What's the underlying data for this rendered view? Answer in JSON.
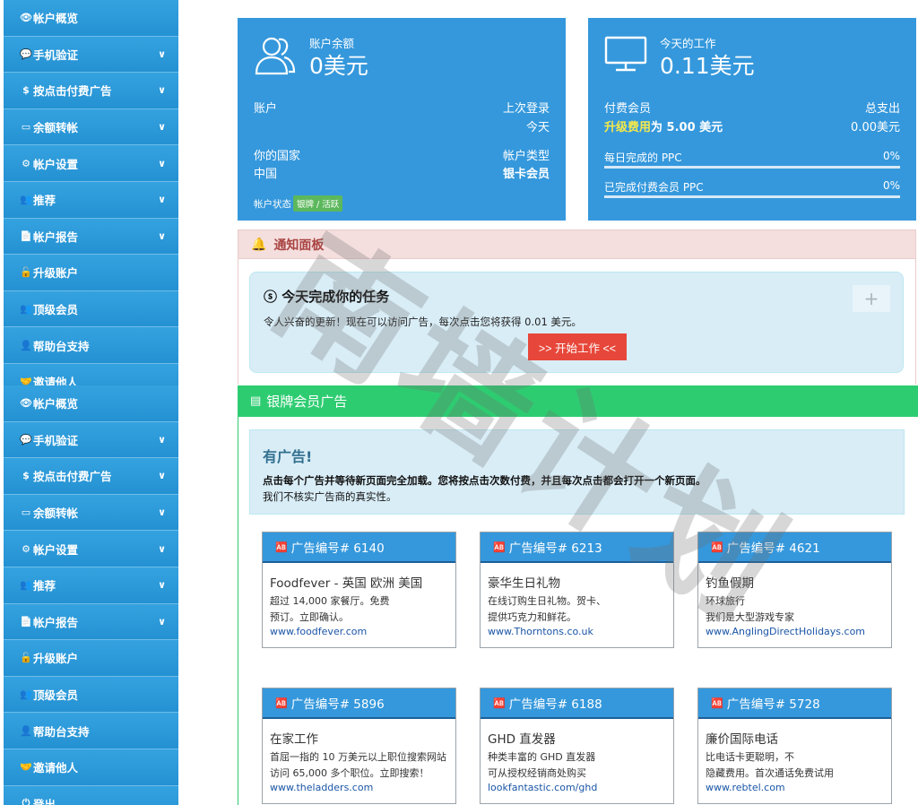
{
  "sidebar_top": {
    "items": [
      {
        "icon": "👁",
        "label": "帐户概览",
        "chevron": ""
      },
      {
        "icon": "💬",
        "label": "手机验证",
        "chevron": "∨"
      },
      {
        "icon": "$",
        "label": "按点击付费广告",
        "chevron": "∨"
      },
      {
        "icon": "▭",
        "label": "余额转帐",
        "chevron": "∨"
      },
      {
        "icon": "⚙",
        "label": "帐户设置",
        "chevron": "∨"
      },
      {
        "icon": "👥",
        "label": "推荐",
        "chevron": "∨"
      },
      {
        "icon": "📄",
        "label": "帐户报告",
        "chevron": "∨"
      },
      {
        "icon": "🔓",
        "label": "升级账户",
        "chevron": ""
      },
      {
        "icon": "👥",
        "label": "顶级会员",
        "chevron": ""
      },
      {
        "icon": "👤",
        "label": "帮助台支持",
        "chevron": ""
      },
      {
        "icon": "🤝",
        "label": "邀请他人",
        "chevron": ""
      }
    ]
  },
  "sidebar_bottom": {
    "items": [
      {
        "icon": "👁",
        "label": "帐户概览",
        "chevron": ""
      },
      {
        "icon": "💬",
        "label": "手机验证",
        "chevron": "∨"
      },
      {
        "icon": "$",
        "label": "按点击付费广告",
        "chevron": "∨"
      },
      {
        "icon": "▭",
        "label": "余额转帐",
        "chevron": "∨"
      },
      {
        "icon": "⚙",
        "label": "帐户设置",
        "chevron": "∨"
      },
      {
        "icon": "👥",
        "label": "推荐",
        "chevron": "∨"
      },
      {
        "icon": "📄",
        "label": "帐户报告",
        "chevron": "∨"
      },
      {
        "icon": "🔓",
        "label": "升级账户",
        "chevron": ""
      },
      {
        "icon": "👥",
        "label": "顶级会员",
        "chevron": ""
      },
      {
        "icon": "👤",
        "label": "帮助台支持",
        "chevron": ""
      },
      {
        "icon": "🤝",
        "label": "邀请他人",
        "chevron": ""
      },
      {
        "icon": "⏻",
        "label": "登出",
        "chevron": ""
      }
    ]
  },
  "account_card": {
    "caption": "账户余额",
    "balance": "0美元",
    "account_label": "账户",
    "last_login_label": "上次登录",
    "last_login_value": "今天",
    "country_label": "你的国家",
    "country_value": "中国",
    "type_label": "帐户类型",
    "type_value": "银卡会员",
    "status_label": "帐户状态",
    "status_badge": "银牌 / 活跃"
  },
  "work_card": {
    "caption": "今天的工作",
    "amount": "0.11美元",
    "paid_label": "付费会员",
    "upgrade_hl": "升级费用",
    "upgrade_rest": "为 5.00 美元",
    "total_label": "总支出",
    "total_value": "0.00美元",
    "daily_label": "每日完成的 PPC",
    "daily_value": "0%",
    "daily_progress": 0,
    "paid_ppc_label": "已完成付费会员 PPC",
    "paid_ppc_value": "0%",
    "paid_ppc_progress": 0
  },
  "notice": {
    "header": "通知面板",
    "task_title": "今天完成你的任务",
    "task_desc": "令人兴奋的更新！现在可以访问广告，每次点击您将获得 0.01 美元。",
    "start_button": ">> 开始工作 <<",
    "plus": "+"
  },
  "ads": {
    "header": "银牌会员广告",
    "info_title": "有广告!",
    "info_line1": "点击每个广告并等待新页面完全加载。您将按点击次数付费，并且每次点击都会打开一个新页面。",
    "info_line2": "我们不核实广告商的真实性。",
    "items": [
      {
        "head": "广告编号# 6140",
        "title": "Foodfever - 英国 欧洲 美国",
        "l1": "超过 14,000 家餐厅。免费",
        "l2": "预订。立即确认。",
        "url": "www.foodfever.com"
      },
      {
        "head": "广告编号# 6213",
        "title": "豪华生日礼物",
        "l1": "在线订购生日礼物。贺卡、",
        "l2": "提供巧克力和鲜花。",
        "url": "www.Thorntons.co.uk"
      },
      {
        "head": "广告编号# 4621",
        "title": "钓鱼假期",
        "l1": "环球旅行",
        "l2": "我们是大型游戏专家",
        "url": "www.AnglingDirectHolidays.com"
      },
      {
        "head": "广告编号# 5896",
        "title": "在家工作",
        "l1": "首屈一指的 10 万美元以上职位搜索网站",
        "l2": "访问 65,000 多个职位。立即搜索！",
        "url": "www.theladders.com"
      },
      {
        "head": "广告编号# 6188",
        "title": "GHD 直发器",
        "l1": "种类丰富的 GHD 直发器",
        "l2": "可从授权经销商处购买",
        "url": "lookfantastic.com/ghd"
      },
      {
        "head": "广告编号# 5728",
        "title": "廉价国际电话",
        "l1": "比电话卡更聪明，不",
        "l2": "隐藏费用。首次通话免费试用",
        "url": "www.rebtel.com"
      }
    ]
  },
  "watermark": "南墙计划",
  "colors": {
    "primary": "#3598dc",
    "success": "#2ecc71",
    "danger": "#e7473a",
    "info_bg": "#d9edf7"
  }
}
